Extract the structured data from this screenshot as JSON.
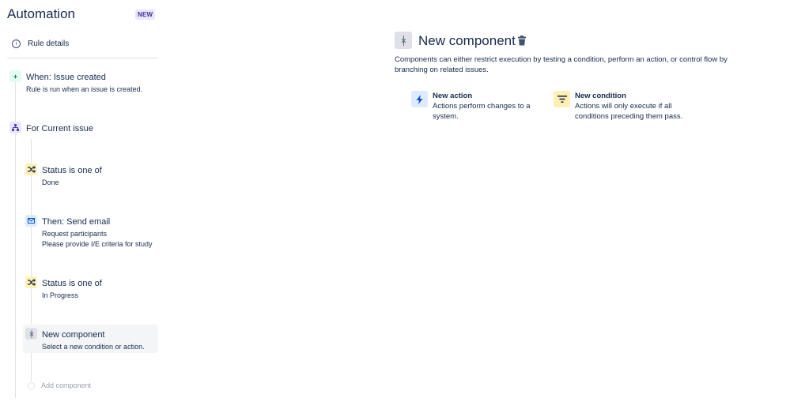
{
  "sidebar": {
    "title": "Automation",
    "badge": "NEW",
    "rule_details": "Rule details",
    "trigger": {
      "title": "When: Issue created",
      "subtitle": "Rule is run when an issue is created."
    },
    "branch": {
      "title": "For Current issue"
    },
    "components": [
      {
        "title": "Status is one of",
        "lines": [
          "Done"
        ]
      },
      {
        "title": "Then: Send email",
        "lines": [
          "Request participants",
          "Please provide I/E criteria for study"
        ]
      },
      {
        "title": "Status is one of",
        "lines": [
          "In Progress"
        ]
      },
      {
        "title": "New component",
        "lines": [
          "Select a new condition or action."
        ]
      }
    ],
    "add_component": "Add component"
  },
  "main": {
    "title": "New component",
    "description": "Components can either restrict execution by testing a condition, perform an action, or control flow by branching on related issues.",
    "options": [
      {
        "title": "New action",
        "description": "Actions perform changes to a system.",
        "icon": "lightning-icon",
        "color": "#deebff"
      },
      {
        "title": "New condition",
        "description": "Actions will only execute if all conditions preceding them pass.",
        "icon": "filter-icon",
        "color": "#fff0b3"
      }
    ]
  },
  "colors": {
    "text": "#172b4d",
    "trigger": "#00875a",
    "branch": "#5243aa",
    "condition": "#fff0b3",
    "action": "#deebff",
    "selected": "#f4f5f7"
  }
}
